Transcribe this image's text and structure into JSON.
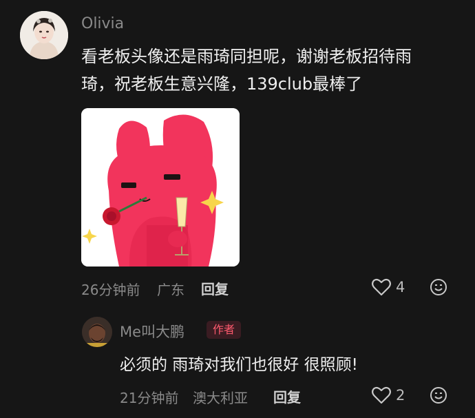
{
  "comments": [
    {
      "username": "Olivia",
      "text_line1": "看老板头像还是雨琦同担呢，谢谢老板招待雨",
      "text_line2": "琦，祝老板生意兴隆，139club最棒了",
      "time": "26分钟前",
      "location": "广东",
      "reply_label": "回复",
      "likes": "4",
      "sticker": "pink-rabbit-rose-champagne-sticker"
    },
    {
      "username": "Me叫大鹏",
      "badge": "作者",
      "text": "必须的 雨琦对我们也很好 很照顾!",
      "time": "21分钟前",
      "location": "澳大利亚",
      "reply_label": "回复",
      "likes": "2"
    }
  ],
  "colors": {
    "background": "#161616",
    "muted_text": "#8a8a8a",
    "badge_text": "#ff5a6e",
    "sticker_pink": "#f2345c"
  },
  "icons": [
    "heart-icon",
    "smiley-icon"
  ]
}
